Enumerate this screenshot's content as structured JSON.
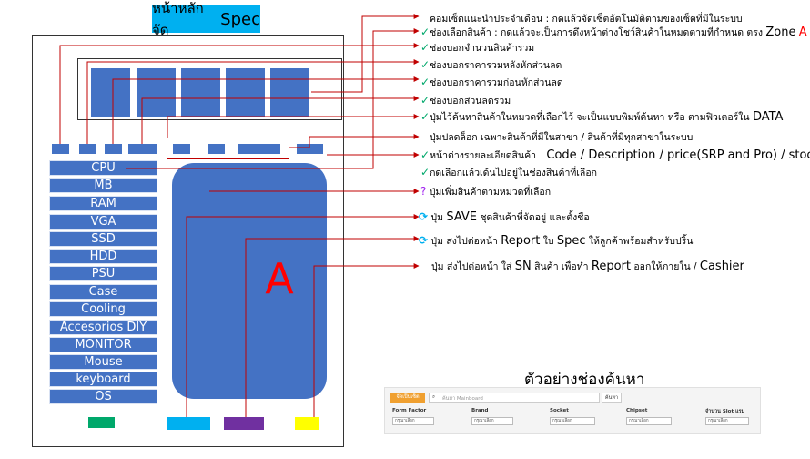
{
  "title": {
    "prefix": "หน้าหลัก จัด",
    "emphasis": "Spec"
  },
  "categories": [
    "CPU",
    "MB",
    "RAM",
    "VGA",
    "SSD",
    "HDD",
    "PSU",
    "Case",
    "Cooling",
    "Accesorios DIY",
    "MONITOR",
    "Mouse",
    "keyboard",
    "OS"
  ],
  "zone_label": "A",
  "colors": {
    "block": "#4472c4",
    "title_bg": "#00b0f0",
    "arrow": "#c00000",
    "btn_green": "#00a86b",
    "btn_cyan": "#00b0f0",
    "btn_purple": "#7030a0",
    "btn_yellow": "#ffff00"
  },
  "annotations": [
    {
      "mark": "",
      "text": "คอมเซ็ตแนะนำประจำเดือน : กดแล้วจัดเซ็ตอัตโนมัติตามของเซ็ตที่มีในระบบ"
    },
    {
      "mark": "✓",
      "text": "ช่องเลือกสินค้า : กดแล้วจะเป็นการดึงหน้าต่างโชว์สินค้าในหมดตามที่กำหนด ตรง",
      "em": "Zone",
      "red": "A"
    },
    {
      "mark": "✓",
      "text": "ช่องบอกจำนวนสินค้ารวม"
    },
    {
      "mark": "✓",
      "text": "ช่องบอกราคารวมหลังหักส่วนลด"
    },
    {
      "mark": "✓",
      "text": "ช่องบอกราคารวมก่อนหักส่วนลด"
    },
    {
      "mark": "✓",
      "text": "ช่องบอกส่วนลดรวม"
    },
    {
      "mark": "✓",
      "text": "ปุ่มไว้ค้นหาสินค้าในหมวดที่เลือกไว้ จะเป็นแบบพิมพ์ค้นหา หรือ ตามฟิวเตอร์ใน",
      "em": "DATA"
    },
    {
      "mark": "",
      "text": "ปุ่มปลดล็อก เฉพาะสินค้าที่มีในสาขา / สินค้าที่มีทุกสาขาในระบบ"
    },
    {
      "mark": "✓",
      "text": "หน้าต่างรายละเอียดสินค้า",
      "em": "Code / Description / price(SRP and Pro) / stock"
    },
    {
      "mark": "✓",
      "text": "กดเลือกแล้วเด้นไปอยู่ในช่องสินค้าที่เลือก"
    },
    {
      "mark": "?",
      "text": "ปุ่มเพิ่มสินค้าตามหมวดที่เลือก"
    },
    {
      "mark": "⟳",
      "text": "ปุ่ม",
      "em": "SAVE",
      "text2": "ชุดสินค้าที่จัดอยู่ และตั้งชื่อ"
    },
    {
      "mark": "⟳",
      "text": "ปุ่ม ส่งไปต่อหน้า",
      "em": "Report",
      "text2": "ใบ",
      "em2": "Spec",
      "text3": "ให้ลูกค้าพร้อมสำหรับปริ้น"
    },
    {
      "mark": "",
      "text": "ปุ่ม ส่งไปต่อหน้า ใส่",
      "em": "SN",
      "text2": "สินค้า เพื่อทำ",
      "em2": "Report",
      "text3": "ออกให้ภายใน /",
      "em3": "Cashier"
    }
  ],
  "example": {
    "title": "ตัวอย่างช่องค้นหา",
    "category_button": "จัดเป็นเซ็ต",
    "search_placeholder": "ค้นหา Mainboard",
    "search_button": "ค้นหา",
    "filters": [
      {
        "label": "Form Factor",
        "value": "กรุณาเลือก"
      },
      {
        "label": "Brand",
        "value": "กรุณาเลือก"
      },
      {
        "label": "Socket",
        "value": "กรุณาเลือก"
      },
      {
        "label": "Chipset",
        "value": "กรุณาเลือก"
      },
      {
        "label": "จำนวน Slot แรม",
        "value": "กรุณาเลือก"
      }
    ]
  }
}
